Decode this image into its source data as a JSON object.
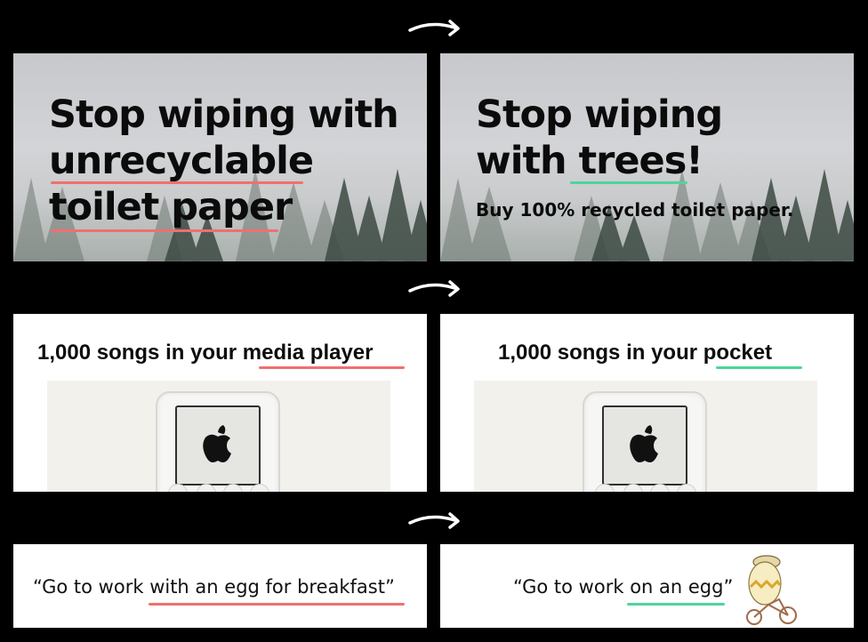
{
  "rows": [
    {
      "before": {
        "lines": [
          "Stop wiping with",
          "unrecyclable",
          "toilet paper"
        ]
      },
      "after": {
        "lines": [
          "Stop wiping",
          "with trees!"
        ],
        "subtitle": "Buy 100% recycled toilet paper."
      }
    },
    {
      "before": {
        "prefix": "1,000 songs in your ",
        "highlight": "media player"
      },
      "after": {
        "prefix": "1,000 songs in your ",
        "highlight": "pocket"
      }
    },
    {
      "before": {
        "prefix": "“Go to work ",
        "highlight": "with an egg for breakfast",
        "suffix": "”"
      },
      "after": {
        "prefix": "“Go to work ",
        "highlight": "on an egg",
        "suffix": "”"
      }
    }
  ],
  "colors": {
    "before_underline": "#f06f6f",
    "after_underline": "#4fd59a",
    "background": "#000000"
  },
  "icons": [
    "arrow-right-icon",
    "apple-logo-icon",
    "egg-on-bicycle-icon"
  ]
}
